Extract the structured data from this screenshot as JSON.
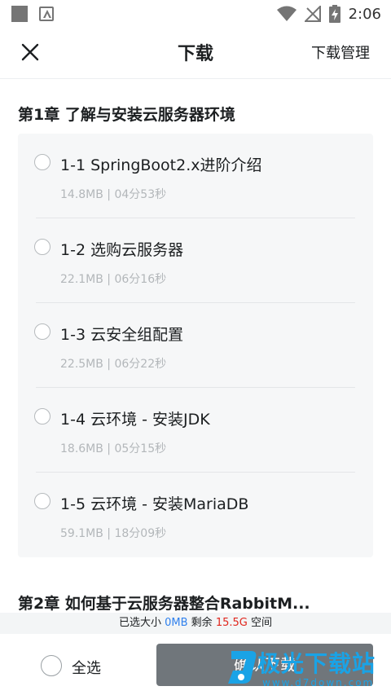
{
  "status_bar": {
    "time": "2:06"
  },
  "header": {
    "title": "下载",
    "manage_label": "下载管理"
  },
  "chapters": [
    {
      "title": "第1章 了解与安装云服务器环境",
      "lessons": [
        {
          "title": "1-1 SpringBoot2.x进阶介绍",
          "meta": "14.8MB | 04分53秒"
        },
        {
          "title": "1-2 选购云服务器",
          "meta": "22.1MB | 06分16秒"
        },
        {
          "title": "1-3 云安全组配置",
          "meta": "22.5MB | 06分22秒"
        },
        {
          "title": "1-4 云环境 - 安装JDK",
          "meta": "18.6MB | 05分15秒"
        },
        {
          "title": "1-5 云环境 - 安装MariaDB",
          "meta": "59.1MB | 18分09秒"
        }
      ]
    },
    {
      "title": "第2章 如何基于云服务器整合RabbitM..."
    }
  ],
  "storage": {
    "selected_label": "已选大小",
    "selected_value": "0MB",
    "remaining_label": "剩余",
    "remaining_value": "15.5G",
    "space_label": "空间"
  },
  "footer": {
    "select_all_label": "全选",
    "confirm_label": "确认下载"
  },
  "watermark": {
    "name": "极光下载站",
    "url": "www.d7down.com"
  },
  "colors": {
    "accent_blue": "#2f80ed",
    "accent_red": "#e0261d",
    "button_gray": "#70767b",
    "watermark_blue": "#1aa3e6"
  }
}
